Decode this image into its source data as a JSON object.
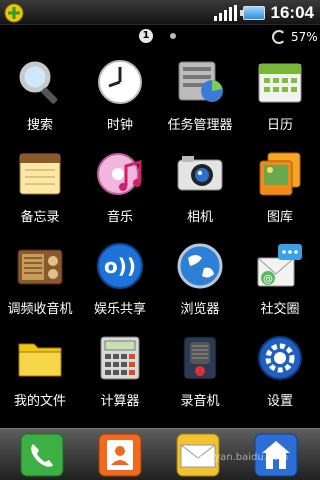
{
  "status_bar": {
    "time": "16:04",
    "battery_percent": "57%",
    "page_number": "1"
  },
  "apps": [
    {
      "label": "搜索",
      "icon": "search-icon"
    },
    {
      "label": "时钟",
      "icon": "clock-icon"
    },
    {
      "label": "任务管理器",
      "icon": "task-manager-icon"
    },
    {
      "label": "日历",
      "icon": "calendar-icon"
    },
    {
      "label": "备忘录",
      "icon": "memo-icon"
    },
    {
      "label": "音乐",
      "icon": "music-icon"
    },
    {
      "label": "相机",
      "icon": "camera-icon"
    },
    {
      "label": "图库",
      "icon": "gallery-icon"
    },
    {
      "label": "调频收音机",
      "icon": "radio-icon"
    },
    {
      "label": "娱乐共享",
      "icon": "share-icon"
    },
    {
      "label": "浏览器",
      "icon": "browser-icon"
    },
    {
      "label": "社交圈",
      "icon": "social-icon"
    },
    {
      "label": "我的文件",
      "icon": "folder-icon"
    },
    {
      "label": "计算器",
      "icon": "calculator-icon"
    },
    {
      "label": "录音机",
      "icon": "recorder-icon"
    },
    {
      "label": "设置",
      "icon": "settings-icon"
    }
  ],
  "dock": [
    {
      "icon": "phone-icon"
    },
    {
      "icon": "contacts-icon"
    },
    {
      "icon": "messages-icon"
    },
    {
      "icon": "home-icon"
    }
  ],
  "watermark": "jingyan.baidu.com"
}
